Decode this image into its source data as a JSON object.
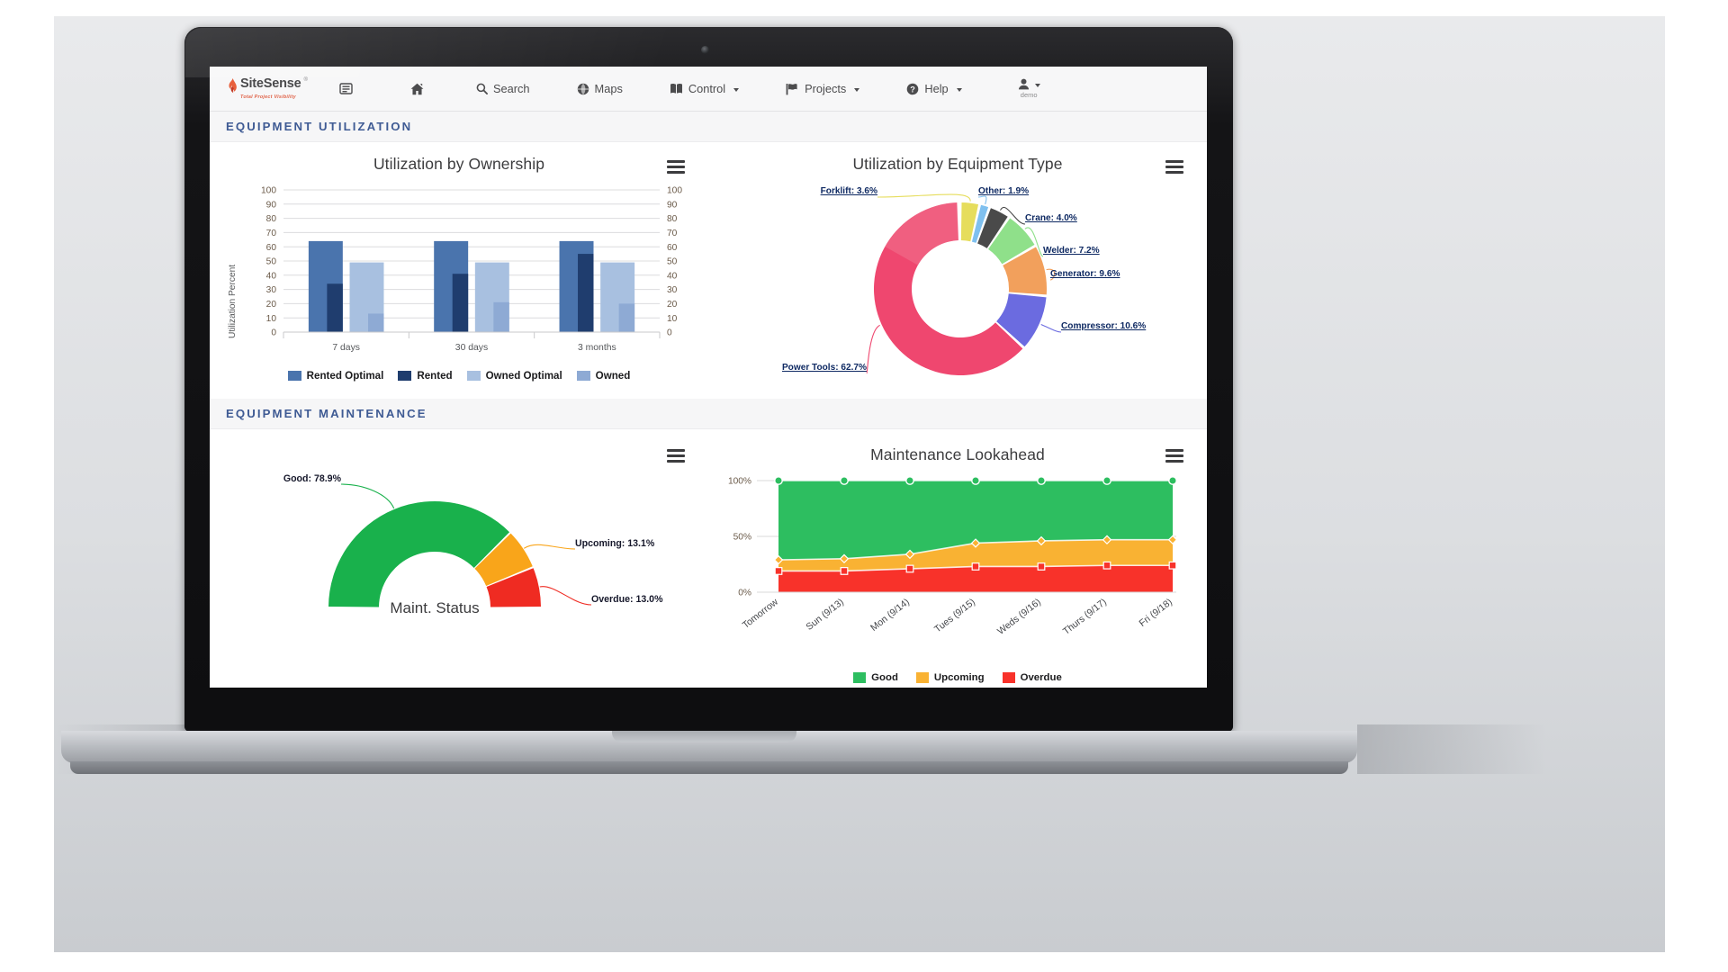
{
  "app": {
    "brand_name": "SiteSense",
    "brand_tm": "®",
    "brand_tagline": "Total Project Visibility",
    "nav": [
      {
        "id": "reports",
        "label": "",
        "icon": "report-icon",
        "caret": false
      },
      {
        "id": "home",
        "label": "",
        "icon": "home-icon",
        "caret": false
      },
      {
        "id": "search",
        "label": "Search",
        "icon": "search-icon",
        "caret": false
      },
      {
        "id": "maps",
        "label": "Maps",
        "icon": "globe-icon",
        "caret": false
      },
      {
        "id": "control",
        "label": "Control",
        "icon": "book-icon",
        "caret": true
      },
      {
        "id": "projects",
        "label": "Projects",
        "icon": "flag-icon",
        "caret": true
      },
      {
        "id": "help",
        "label": "Help",
        "icon": "help-circle-icon",
        "caret": true
      }
    ],
    "user": {
      "name": "demo",
      "icon": "user-icon"
    }
  },
  "sections": {
    "utilization": "EQUIPMENT UTILIZATION",
    "maintenance": "EQUIPMENT MAINTENANCE"
  },
  "menu_icon": "hamburger-menu-icon",
  "chart_data": [
    {
      "id": "utilization-by-ownership",
      "type": "bar",
      "title": "Utilization by Ownership",
      "xlabel": "",
      "ylabel": "Utilization Percent",
      "ylim": [
        0,
        100
      ],
      "yticks": [
        0,
        10,
        20,
        30,
        40,
        50,
        60,
        70,
        80,
        90,
        100
      ],
      "grid": true,
      "categories": [
        "7 days",
        "30 days",
        "3 months"
      ],
      "series": [
        {
          "name": "Rented Optimal",
          "color": "#4a74ad",
          "values": [
            64,
            64,
            64
          ]
        },
        {
          "name": "Rented",
          "color": "#1f3d6e",
          "values": [
            34,
            41,
            55
          ]
        },
        {
          "name": "Owned Optimal",
          "color": "#a8c0e0",
          "values": [
            49,
            49,
            49
          ]
        },
        {
          "name": "Owned",
          "color": "#8eaad4",
          "values": [
            13,
            21,
            20
          ]
        }
      ],
      "legend_position": "bottom"
    },
    {
      "id": "utilization-by-equipment-type",
      "type": "pie",
      "title": "Utilization by Equipment Type",
      "donut": true,
      "slices": [
        {
          "label": "Power Tools",
          "value": 62.7,
          "display": "Power Tools: 62.7%",
          "color": "#ef476f"
        },
        {
          "label": "Forklift",
          "value": 3.6,
          "display": "Forklift: 3.6%",
          "color": "#e6dd5c"
        },
        {
          "label": "Other",
          "value": 1.9,
          "display": "Other: 1.9%",
          "color": "#7fc0ef"
        },
        {
          "label": "Crane",
          "value": 4.0,
          "display": "Crane: 4.0%",
          "color": "#4a4a4a"
        },
        {
          "label": "Welder",
          "value": 7.2,
          "display": "Welder: 7.2%",
          "color": "#8fe08a"
        },
        {
          "label": "Generator",
          "value": 9.6,
          "display": "Generator: 9.6%",
          "color": "#f2a05c"
        },
        {
          "label": "Compressor",
          "value": 10.6,
          "display": "Compressor: 10.6%",
          "color": "#6b6be0"
        }
      ]
    },
    {
      "id": "maintenance-status",
      "type": "pie",
      "title": "Maint. Status",
      "gauge": true,
      "center_label": "Maint. Status",
      "slices": [
        {
          "label": "Good",
          "value": 78.9,
          "display": "Good: 78.9%",
          "color": "#19b14c"
        },
        {
          "label": "Upcoming",
          "value": 13.1,
          "display": "Upcoming: 13.1%",
          "color": "#f9a51a"
        },
        {
          "label": "Overdue",
          "value": 13.0,
          "display": "Overdue: 13.0%",
          "color": "#ef2b22"
        }
      ]
    },
    {
      "id": "maintenance-lookahead",
      "type": "area",
      "title": "Maintenance Lookahead",
      "stacked": true,
      "ylim": [
        0,
        100
      ],
      "yticks": [
        "0%",
        "50%",
        "100%"
      ],
      "grid": true,
      "categories": [
        "Tomorrow",
        "Sun (9/13)",
        "Mon (9/14)",
        "Tues (9/15)",
        "Weds (9/16)",
        "Thurs (9/17)",
        "Fri (9/18)"
      ],
      "series": [
        {
          "name": "Good",
          "color": "#2dbe60",
          "values": [
            100,
            100,
            100,
            100,
            100,
            100,
            100
          ]
        },
        {
          "name": "Upcoming",
          "color": "#f9b233",
          "values": [
            29,
            30,
            34,
            44,
            46,
            47,
            47
          ]
        },
        {
          "name": "Overdue",
          "color": "#f8322a",
          "values": [
            19,
            19,
            21,
            23,
            23,
            24,
            24
          ]
        }
      ],
      "legend_position": "bottom"
    }
  ]
}
